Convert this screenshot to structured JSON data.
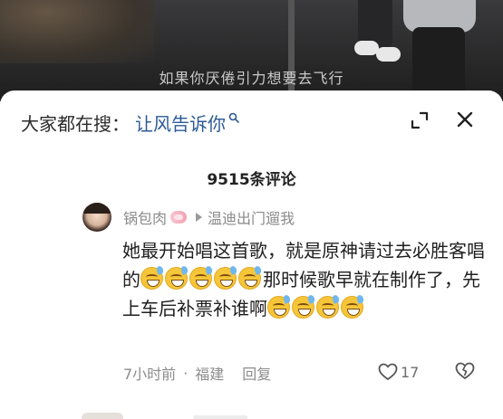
{
  "video": {
    "subtitle": "如果你厌倦引力想要去飞行"
  },
  "search_bar": {
    "prefix": "大家都在搜：",
    "term": "让风告诉你",
    "icon": "search-icon"
  },
  "panel": {
    "expand_icon": "expand-icon",
    "close_icon": "close-icon",
    "comment_count": "9515条评论"
  },
  "comment": {
    "username": "锅包肉",
    "reply_target": "温迪出门遛我",
    "text_1": "她最开始唱这首歌，就是原神请过去必胜客唱的",
    "text_2": "那时候歌早就在制作了，先上车后补票补谁啊",
    "time": "7小时前",
    "separator": "·",
    "location": "福建",
    "reply_label": "回复",
    "like_count": "17",
    "emoji_name": "grinning-sweat-emoji"
  }
}
